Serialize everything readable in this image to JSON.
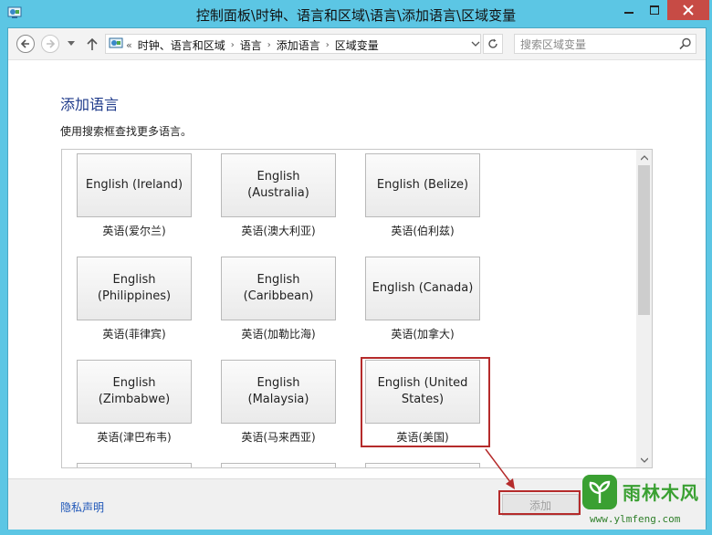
{
  "window": {
    "title": "控制面板\\时钟、语言和区域\\语言\\添加语言\\区域变量"
  },
  "address_bar": {
    "overflow": "«",
    "crumbs": [
      "时钟、语言和区域",
      "语言",
      "添加语言",
      "区域变量"
    ]
  },
  "search": {
    "placeholder": "搜索区域变量",
    "value": ""
  },
  "page": {
    "title": "添加语言",
    "instruction": "使用搜索框查找更多语言。"
  },
  "languages": [
    {
      "name": "English (Ireland)",
      "label": "英语(爱尔兰)"
    },
    {
      "name": "English (Australia)",
      "label": "英语(澳大利亚)"
    },
    {
      "name": "English (Belize)",
      "label": "英语(伯利兹)"
    },
    {
      "name": "English (Philippines)",
      "label": "英语(菲律宾)"
    },
    {
      "name": "English (Caribbean)",
      "label": "英语(加勒比海)"
    },
    {
      "name": "English (Canada)",
      "label": "英语(加拿大)"
    },
    {
      "name": "English (Zimbabwe)",
      "label": "英语(津巴布韦)"
    },
    {
      "name": "English (Malaysia)",
      "label": "英语(马来西亚)"
    },
    {
      "name": "English (United States)",
      "label": "英语(美国)",
      "selected": true
    }
  ],
  "footer": {
    "privacy_link": "隐私声明",
    "add_button": "添加",
    "add_enabled": false
  },
  "watermark": {
    "name": "雨林木风",
    "url": "www.ylmfeng.com"
  },
  "colors": {
    "window_frame": "#5cc6e4",
    "close_button": "#c74b45",
    "title_link": "#1e3a8a",
    "highlight": "#b52b2b",
    "watermark_green": "#3aa032"
  }
}
